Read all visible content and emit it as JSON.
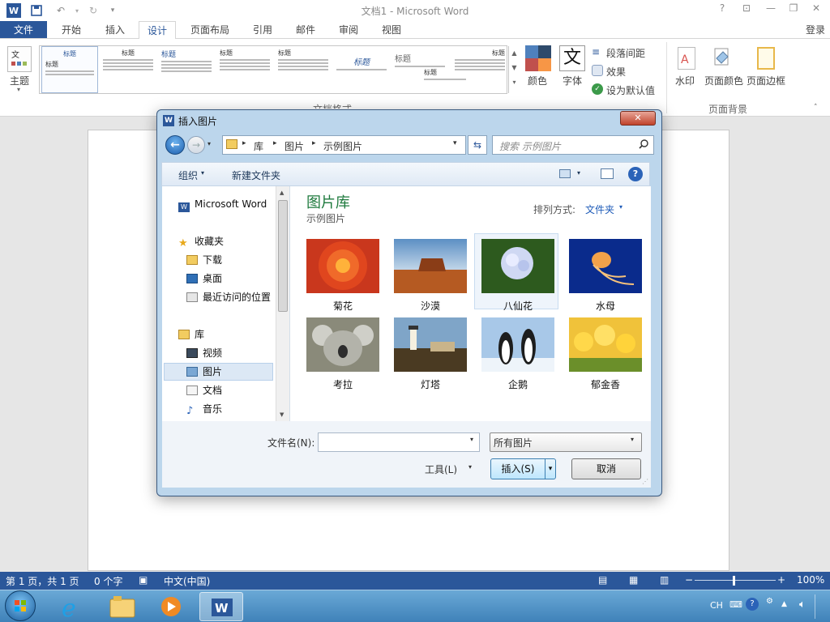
{
  "app": {
    "title": "文档1 - Microsoft Word",
    "login": "登录"
  },
  "window_buttons": {
    "help": "?",
    "ribbon_display": "⊡",
    "minimize": "—",
    "restore": "❐",
    "close": "✕"
  },
  "tabs": [
    {
      "label": "文件"
    },
    {
      "label": "开始"
    },
    {
      "label": "插入"
    },
    {
      "label": "设计"
    },
    {
      "label": "页面布局"
    },
    {
      "label": "引用"
    },
    {
      "label": "邮件"
    },
    {
      "label": "审阅"
    },
    {
      "label": "视图"
    }
  ],
  "ribbon": {
    "theme_label": "主题",
    "themes_gallery": [
      "标题",
      "标题",
      "标题",
      "标题",
      "标题",
      "标题",
      "标题",
      "标题",
      "标题",
      "标题"
    ],
    "gallery_caption": "文档格式",
    "colors_label": "颜色",
    "fonts_label": "字体",
    "paragraph_spacing": "段落间距",
    "effects": "效果",
    "set_default": "设为默认值",
    "watermark": "水印",
    "page_color": "页面颜色",
    "page_borders": "页面边框",
    "page_bg_group": "页面背景"
  },
  "status_bar": {
    "page": "第 1 页，共 1 页",
    "words": "0 个字",
    "language": "中文(中国)",
    "zoom": "100%"
  },
  "taskbar": {
    "tray_lang": "CH"
  },
  "dialog": {
    "title": "插入图片",
    "close": "✕",
    "breadcrumb": [
      "库",
      "图片",
      "示例图片"
    ],
    "search_placeholder": "搜索 示例图片",
    "organize": "组织",
    "new_folder": "新建文件夹",
    "nav": {
      "word": "Microsoft Word",
      "favorites": "收藏夹",
      "favorites_items": [
        "下载",
        "桌面",
        "最近访问的位置"
      ],
      "libraries": "库",
      "library_items": [
        "视频",
        "图片",
        "文档",
        "音乐"
      ]
    },
    "library_title": "图片库",
    "library_subtitle": "示例图片",
    "arrange_label": "排列方式:",
    "arrange_value": "文件夹",
    "files": [
      {
        "name": "菊花"
      },
      {
        "name": "沙漠"
      },
      {
        "name": "八仙花"
      },
      {
        "name": "水母"
      },
      {
        "name": "考拉"
      },
      {
        "name": "灯塔"
      },
      {
        "name": "企鹅"
      },
      {
        "name": "郁金香"
      }
    ],
    "filename_label": "文件名(N):",
    "filename_value": "",
    "filter_value": "所有图片",
    "tools": "工具(L)",
    "insert": "插入(S)",
    "cancel": "取消"
  }
}
